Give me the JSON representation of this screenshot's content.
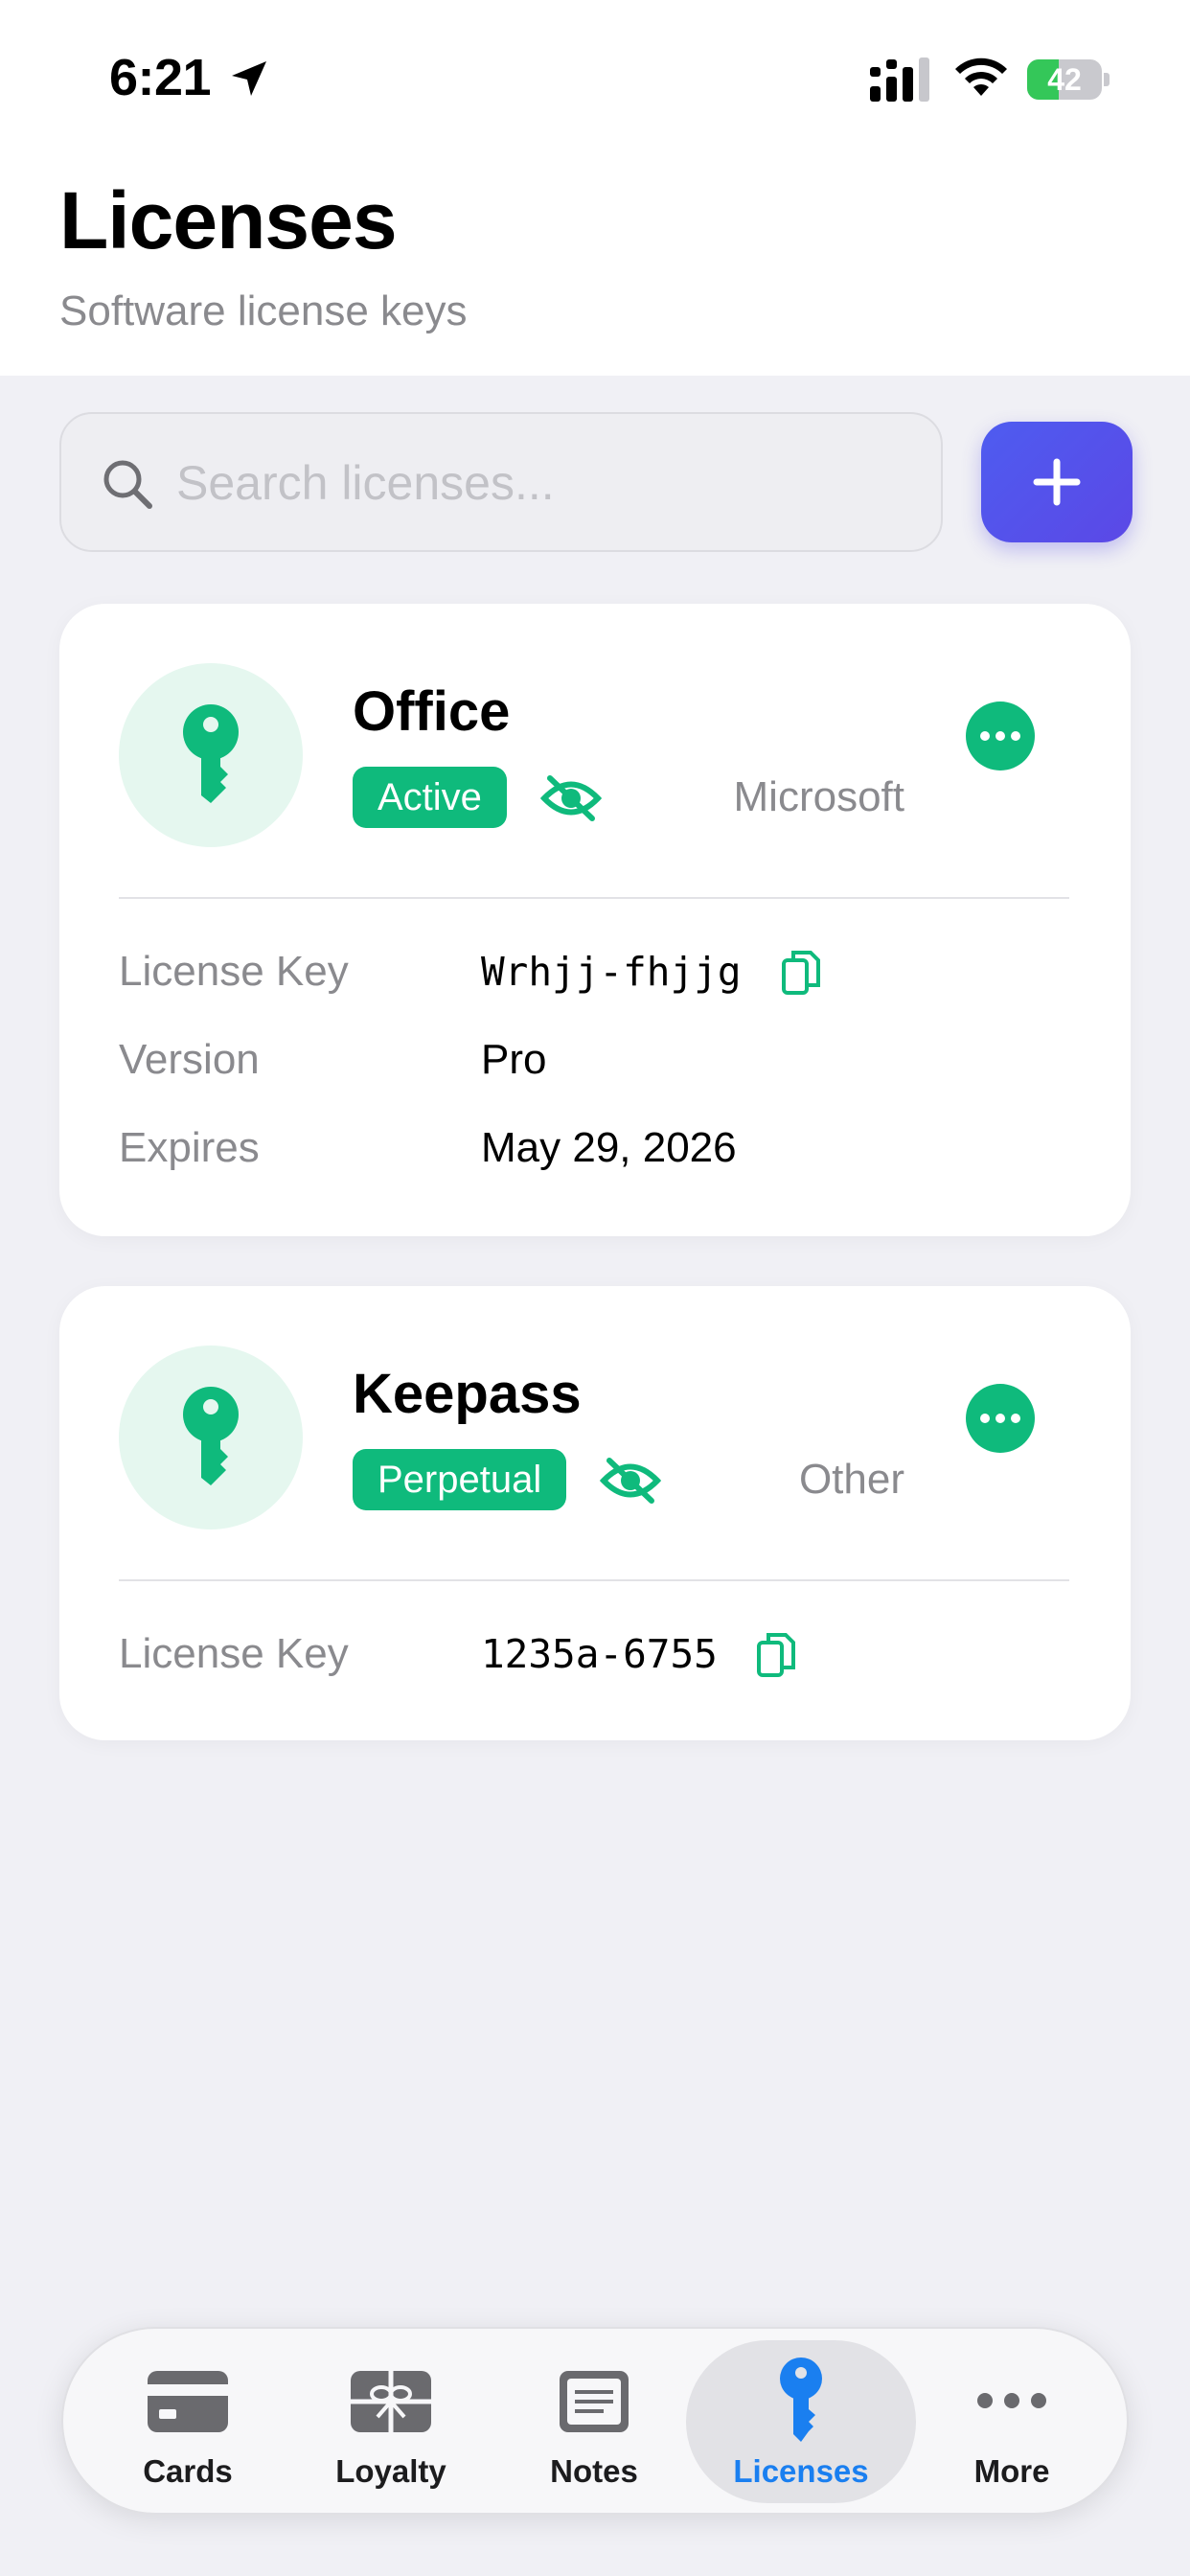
{
  "status_bar": {
    "time": "6:21",
    "battery": "42",
    "battery_level": 0.42
  },
  "header": {
    "title": "Licenses",
    "subtitle": "Software license keys"
  },
  "search": {
    "placeholder": "Search licenses...",
    "value": ""
  },
  "colors": {
    "accent_green": "#0fba7c",
    "add_button": "#5252ec",
    "tab_active": "#1a7ff0"
  },
  "licenses": [
    {
      "name": "Office",
      "status": "Active",
      "vendor": "Microsoft",
      "icon": "key-icon",
      "details": [
        {
          "label": "License Key",
          "value": "Wrhjj-fhjjg"
        },
        {
          "label": "Version",
          "value": "Pro"
        },
        {
          "label": "Expires",
          "value": "May 29, 2026"
        }
      ]
    },
    {
      "name": "Keepass",
      "status": "Perpetual",
      "vendor": "Other",
      "icon": "key-icon",
      "details": [
        {
          "label": "License Key",
          "value": "1235a-6755"
        }
      ]
    }
  ],
  "tabs": [
    {
      "label": "Cards",
      "icon": "credit-card-icon"
    },
    {
      "label": "Loyalty",
      "icon": "gift-card-icon"
    },
    {
      "label": "Notes",
      "icon": "note-icon"
    },
    {
      "label": "Licenses",
      "icon": "key-icon",
      "active": true
    },
    {
      "label": "More",
      "icon": "more-icon"
    }
  ]
}
